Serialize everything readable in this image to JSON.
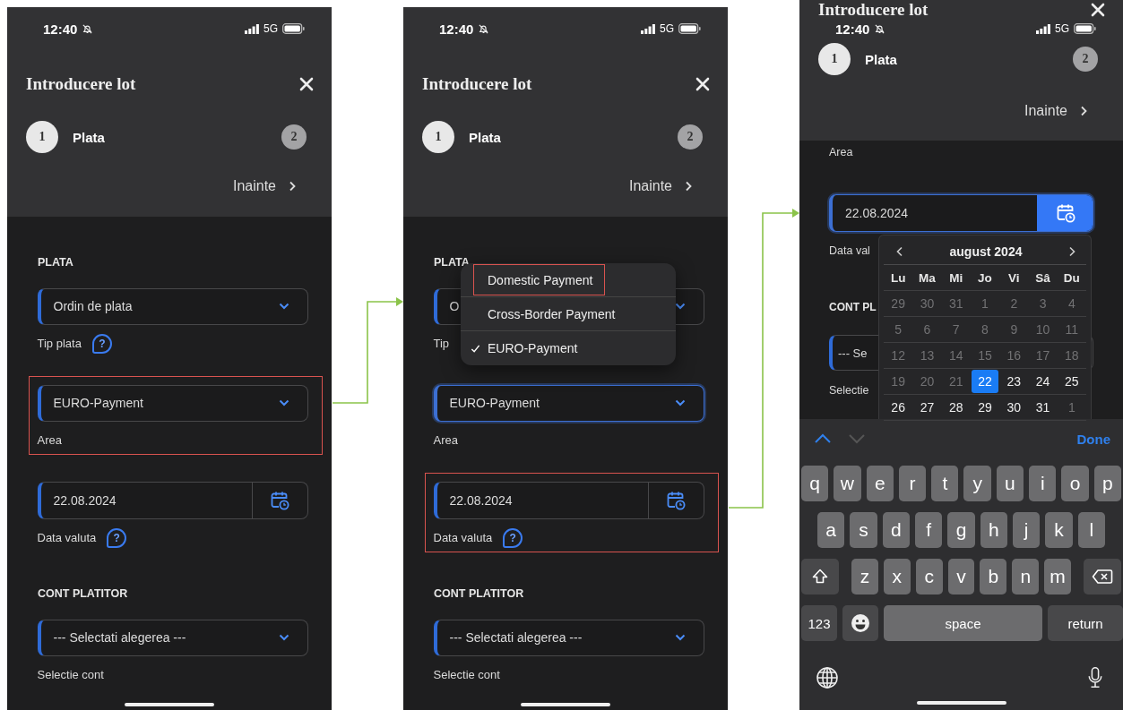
{
  "screens": [
    {
      "kind": "form",
      "status": {
        "time": "12:40",
        "network": "5G"
      },
      "title": "Introducere lot",
      "steps": [
        {
          "number": "1",
          "label": "Plata",
          "selected": true
        },
        {
          "number": "2",
          "selected": false
        }
      ],
      "next": "Inainte",
      "sections": [
        {
          "title": "PLATA",
          "fields": [
            {
              "kind": "select",
              "value": "Ordin de plata",
              "label": "Tip plata",
              "help": "?",
              "focused": false,
              "highlighted": false
            },
            {
              "kind": "select",
              "value": "EURO-Payment",
              "label": "Area",
              "focused": false,
              "highlighted": true
            },
            {
              "kind": "date",
              "value": "22.08.2024",
              "label": "Data valuta",
              "help": "?",
              "focused": false,
              "highlighted": false
            }
          ]
        },
        {
          "title": "CONT PLATITOR",
          "fields": [
            {
              "kind": "select",
              "value": "--- Selectati alegerea ---",
              "label": "Selectie cont",
              "focused": false,
              "highlighted": false
            }
          ]
        }
      ]
    },
    {
      "kind": "form",
      "status": {
        "time": "12:40",
        "network": "5G"
      },
      "title": "Introducere lot",
      "steps": [
        {
          "number": "1",
          "label": "Plata",
          "selected": true
        },
        {
          "number": "2",
          "selected": false
        }
      ],
      "next": "Inainte",
      "sections": [
        {
          "title": "PLATA",
          "fields": [
            {
              "kind": "select",
              "value": "O",
              "label": "Tip",
              "focused": false,
              "highlighted": false
            },
            {
              "kind": "select",
              "value": "EURO-Payment",
              "label": "Area",
              "focused": true,
              "highlighted": false
            },
            {
              "kind": "date",
              "value": "22.08.2024",
              "label": "Data valuta",
              "help": "?",
              "focused": false,
              "highlighted": true
            }
          ]
        },
        {
          "title": "CONT PLATITOR",
          "fields": [
            {
              "kind": "select",
              "value": "--- Selectati alegerea ---",
              "label": "Selectie cont",
              "focused": false,
              "highlighted": false
            }
          ]
        }
      ],
      "menu": {
        "options": [
          {
            "label": "Domestic Payment",
            "selected": false,
            "highlighted": true
          },
          {
            "label": "Cross-Border Payment",
            "selected": false,
            "highlighted": false
          },
          {
            "label": "EURO-Payment",
            "selected": true,
            "highlighted": false
          }
        ]
      }
    },
    {
      "kind": "date-entry",
      "title": "Introducere lot",
      "status": {
        "time": "12:40",
        "network": "5G"
      },
      "steps": [
        {
          "number": "1",
          "label": "Plata",
          "selected": true
        },
        {
          "number": "2",
          "selected": false
        }
      ],
      "next": "Inainte",
      "area_label": "Area",
      "date_field": {
        "value": "22.08.2024",
        "label": "Data val",
        "focused": true,
        "active": true
      },
      "section": "CONT PL",
      "account_field": {
        "value": "--- Se",
        "label": "Selectie",
        "focused": false
      },
      "calendar": {
        "month": "august 2024",
        "weekdays": [
          "Lu",
          "Ma",
          "Mi",
          "Jo",
          "Vi",
          "Sâ",
          "Du"
        ],
        "weeks": [
          [
            {
              "day": "29",
              "disabled": true,
              "selected": false
            },
            {
              "day": "30",
              "disabled": true,
              "selected": false
            },
            {
              "day": "31",
              "disabled": true,
              "selected": false
            },
            {
              "day": "1",
              "disabled": true,
              "selected": false
            },
            {
              "day": "2",
              "disabled": true,
              "selected": false
            },
            {
              "day": "3",
              "disabled": true,
              "selected": false
            },
            {
              "day": "4",
              "disabled": true,
              "selected": false
            }
          ],
          [
            {
              "day": "5",
              "disabled": true,
              "selected": false
            },
            {
              "day": "6",
              "disabled": true,
              "selected": false
            },
            {
              "day": "7",
              "disabled": true,
              "selected": false
            },
            {
              "day": "8",
              "disabled": true,
              "selected": false
            },
            {
              "day": "9",
              "disabled": true,
              "selected": false
            },
            {
              "day": "10",
              "disabled": true,
              "selected": false
            },
            {
              "day": "11",
              "disabled": true,
              "selected": false
            }
          ],
          [
            {
              "day": "12",
              "disabled": true,
              "selected": false
            },
            {
              "day": "13",
              "disabled": true,
              "selected": false
            },
            {
              "day": "14",
              "disabled": true,
              "selected": false
            },
            {
              "day": "15",
              "disabled": true,
              "selected": false
            },
            {
              "day": "16",
              "disabled": true,
              "selected": false
            },
            {
              "day": "17",
              "disabled": true,
              "selected": false
            },
            {
              "day": "18",
              "disabled": true,
              "selected": false
            }
          ],
          [
            {
              "day": "19",
              "disabled": true,
              "selected": false
            },
            {
              "day": "20",
              "disabled": true,
              "selected": false
            },
            {
              "day": "21",
              "disabled": true,
              "selected": false
            },
            {
              "day": "22",
              "disabled": false,
              "selected": true
            },
            {
              "day": "23",
              "disabled": false,
              "selected": false
            },
            {
              "day": "24",
              "disabled": false,
              "selected": false
            },
            {
              "day": "25",
              "disabled": false,
              "selected": false
            }
          ],
          [
            {
              "day": "26",
              "disabled": false,
              "selected": false
            },
            {
              "day": "27",
              "disabled": false,
              "selected": false
            },
            {
              "day": "28",
              "disabled": false,
              "selected": false
            },
            {
              "day": "29",
              "disabled": false,
              "selected": false
            },
            {
              "day": "30",
              "disabled": false,
              "selected": false
            },
            {
              "day": "31",
              "disabled": false,
              "selected": false
            },
            {
              "day": "1",
              "disabled": true,
              "selected": false
            }
          ]
        ]
      },
      "keyboard": {
        "previous": {
          "disabled": false
        },
        "following": {
          "disabled": true
        },
        "done": "Done",
        "rows": [
          {
            "keys": [
              {
                "kind": "letter",
                "label": "q"
              },
              {
                "kind": "letter",
                "label": "w"
              },
              {
                "kind": "letter",
                "label": "e"
              },
              {
                "kind": "letter",
                "label": "r"
              },
              {
                "kind": "letter",
                "label": "t"
              },
              {
                "kind": "letter",
                "label": "y"
              },
              {
                "kind": "letter",
                "label": "u"
              },
              {
                "kind": "letter",
                "label": "i"
              },
              {
                "kind": "letter",
                "label": "o"
              },
              {
                "kind": "letter",
                "label": "p"
              }
            ]
          },
          {
            "keys": [
              {
                "kind": "letter",
                "label": "a"
              },
              {
                "kind": "letter",
                "label": "s"
              },
              {
                "kind": "letter",
                "label": "d"
              },
              {
                "kind": "letter",
                "label": "f"
              },
              {
                "kind": "letter",
                "label": "g"
              },
              {
                "kind": "letter",
                "label": "h"
              },
              {
                "kind": "letter",
                "label": "j"
              },
              {
                "kind": "letter",
                "label": "k"
              },
              {
                "kind": "letter",
                "label": "l"
              }
            ]
          },
          {
            "keys": [
              {
                "kind": "shift"
              },
              {
                "kind": "letter",
                "label": "z"
              },
              {
                "kind": "letter",
                "label": "x"
              },
              {
                "kind": "letter",
                "label": "c"
              },
              {
                "kind": "letter",
                "label": "v"
              },
              {
                "kind": "letter",
                "label": "b"
              },
              {
                "kind": "letter",
                "label": "n"
              },
              {
                "kind": "letter",
                "label": "m"
              },
              {
                "kind": "delete"
              }
            ]
          },
          {
            "keys": [
              {
                "kind": "mode",
                "label": "123"
              },
              {
                "kind": "emoji"
              },
              {
                "kind": "space",
                "label": "space"
              },
              {
                "kind": "return",
                "label": "return"
              }
            ]
          }
        ]
      }
    }
  ]
}
